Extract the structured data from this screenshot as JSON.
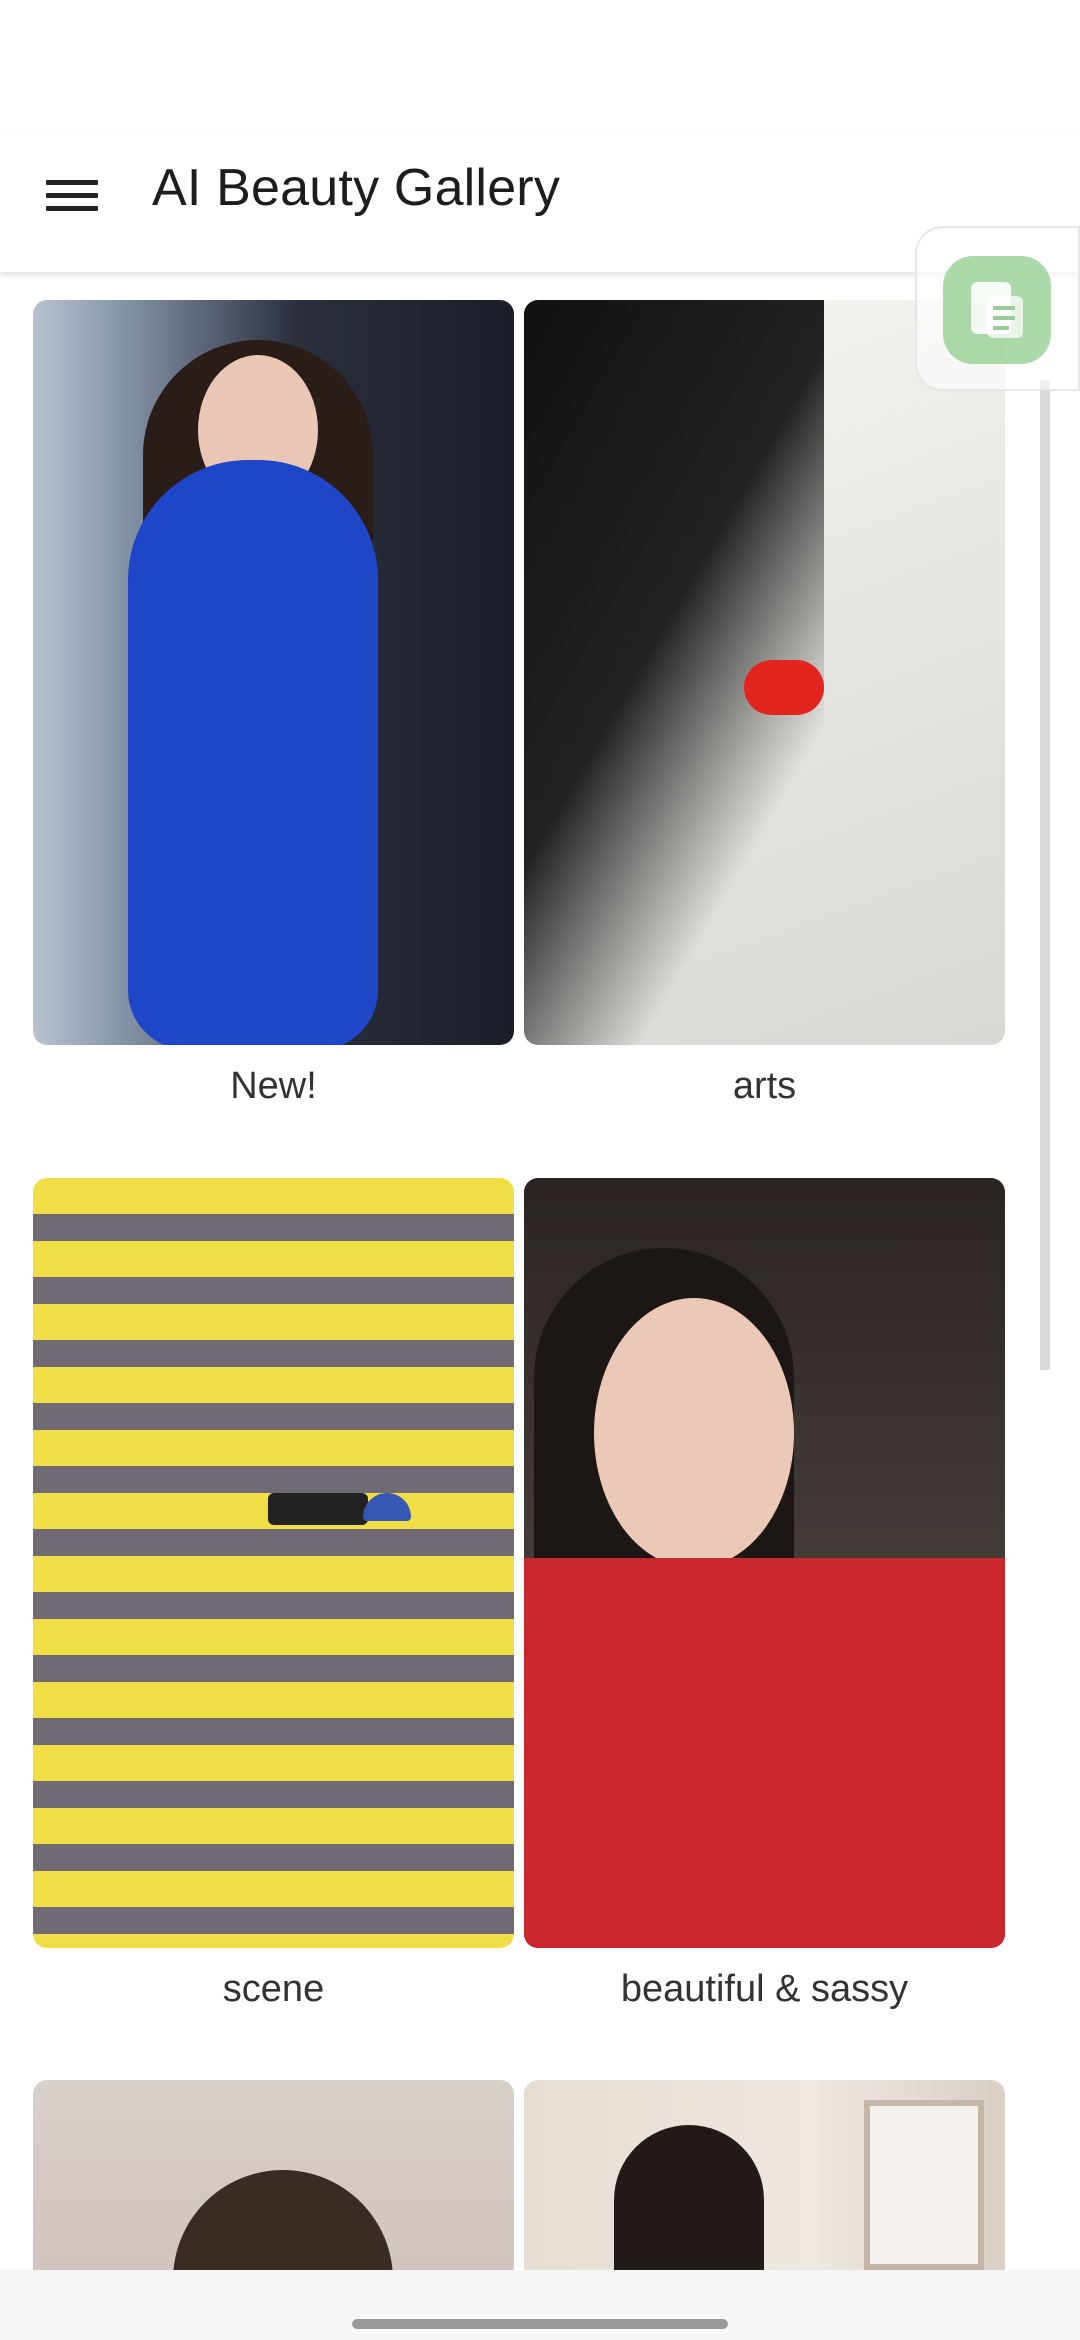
{
  "app_bar": {
    "menu_icon": "hamburger-menu-icon",
    "title": "AI Beauty Gallery"
  },
  "floating_widget": {
    "icon": "document-icon",
    "color": "#9ed39c"
  },
  "gallery": {
    "items": [
      {
        "caption": "New!"
      },
      {
        "caption": "arts"
      },
      {
        "caption": "scene"
      },
      {
        "caption": "beautiful & sassy"
      },
      {
        "caption": ""
      },
      {
        "caption": ""
      }
    ]
  }
}
